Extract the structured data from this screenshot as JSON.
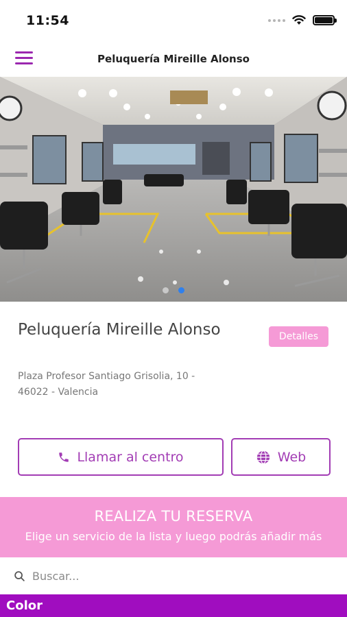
{
  "status_bar": {
    "time": "11:54",
    "icons": [
      "signal-dots-icon",
      "wifi-icon",
      "battery-icon"
    ]
  },
  "nav": {
    "title": "Peluquería Mireille Alonso",
    "menu_icon": "hamburger-menu-icon"
  },
  "carousel": {
    "pages": 2,
    "active_index": 1,
    "active_color": "#2f80ed",
    "inactive_color": "#c9c9c9"
  },
  "salon": {
    "name": "Peluquería Mireille Alonso",
    "details_label": "Detalles",
    "address_line1": "Plaza Profesor Santiago Grisolia, 10 -",
    "address_line2": "46022 - Valencia"
  },
  "actions": {
    "call_label": "Llamar al centro",
    "call_icon": "phone-icon",
    "web_label": "Web",
    "web_icon": "globe-icon"
  },
  "booking": {
    "heading": "REALIZA TU RESERVA",
    "subheading": "Elige un servicio de la lista y luego podrás añadir más"
  },
  "search": {
    "placeholder": "Buscar...",
    "icon": "search-icon"
  },
  "category": {
    "label": "Color"
  },
  "colors": {
    "accent": "#a23cb4",
    "pink": "#f59ad6",
    "category_bar": "#a00dbf"
  }
}
